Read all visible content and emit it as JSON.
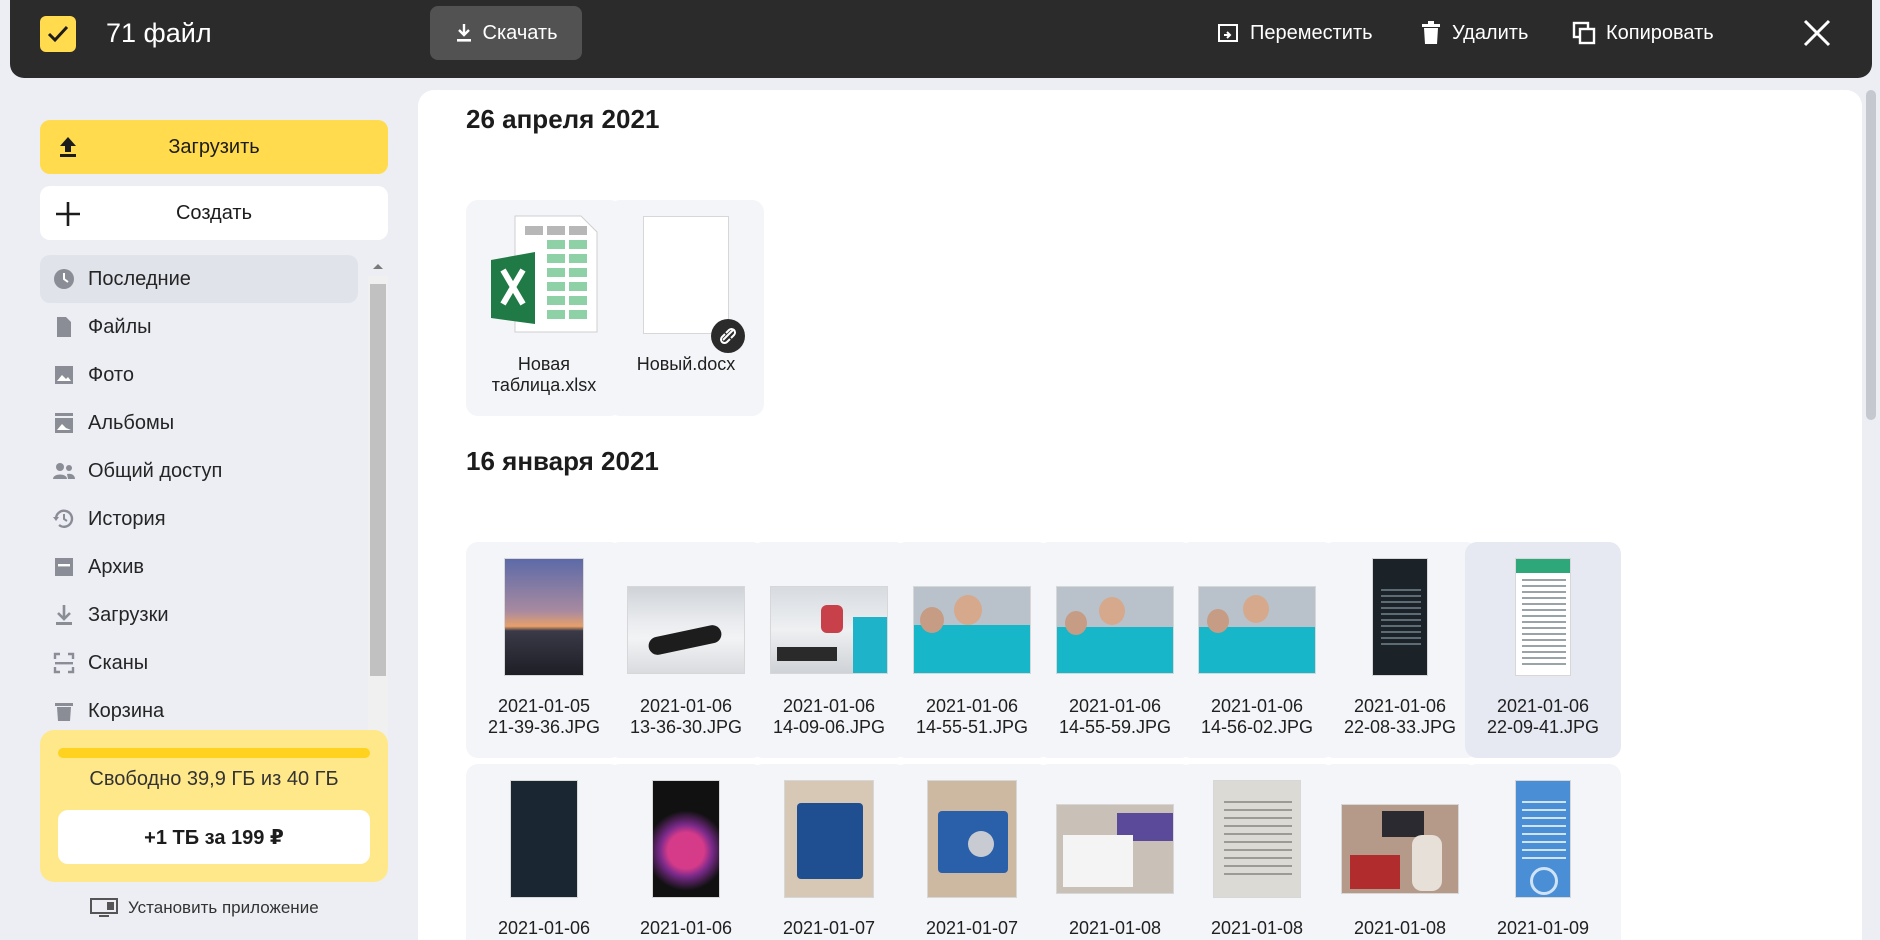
{
  "topbar": {
    "count": "71 файл",
    "download_label": "Скачать",
    "move_label": "Переместить",
    "delete_label": "Удалить",
    "copy_label": "Копировать",
    "accent": "#ffdb4d"
  },
  "sidebar": {
    "upload_label": "Загрузить",
    "create_label": "Создать",
    "items": [
      {
        "label": "Последние",
        "icon": "clock-icon"
      },
      {
        "label": "Файлы",
        "icon": "file-icon"
      },
      {
        "label": "Фото",
        "icon": "photo-icon"
      },
      {
        "label": "Альбомы",
        "icon": "album-icon"
      },
      {
        "label": "Общий доступ",
        "icon": "people-icon"
      },
      {
        "label": "История",
        "icon": "history-icon"
      },
      {
        "label": "Архив",
        "icon": "archive-icon"
      },
      {
        "label": "Загрузки",
        "icon": "download-icon"
      },
      {
        "label": "Сканы",
        "icon": "scan-icon"
      },
      {
        "label": "Корзина",
        "icon": "trash-icon"
      }
    ],
    "storage_text": "Свободно 39,9 ГБ из 40 ГБ",
    "buy_label": "+1 ТБ за 199 ₽",
    "install_label": "Установить приложение"
  },
  "main": {
    "groups": [
      {
        "date": "26 апреля 2021",
        "files": [
          {
            "name1": "Новая",
            "name2": "таблица.xlsx"
          },
          {
            "name1": "Новый.docx",
            "name2": ""
          }
        ]
      },
      {
        "date": "16 января 2021",
        "files": [
          {
            "name1": "2021-01-05",
            "name2": "21-39-36.JPG"
          },
          {
            "name1": "2021-01-06",
            "name2": "13-36-30.JPG"
          },
          {
            "name1": "2021-01-06",
            "name2": "14-09-06.JPG"
          },
          {
            "name1": "2021-01-06",
            "name2": "14-55-51.JPG"
          },
          {
            "name1": "2021-01-06",
            "name2": "14-55-59.JPG"
          },
          {
            "name1": "2021-01-06",
            "name2": "14-56-02.JPG"
          },
          {
            "name1": "2021-01-06",
            "name2": "22-08-33.JPG"
          },
          {
            "name1": "2021-01-06",
            "name2": "22-09-41.JPG"
          },
          {
            "name1": "2021-01-06",
            "name2": ""
          },
          {
            "name1": "2021-01-06",
            "name2": ""
          },
          {
            "name1": "2021-01-07",
            "name2": ""
          },
          {
            "name1": "2021-01-07",
            "name2": ""
          },
          {
            "name1": "2021-01-08",
            "name2": ""
          },
          {
            "name1": "2021-01-08",
            "name2": ""
          },
          {
            "name1": "2021-01-08",
            "name2": ""
          },
          {
            "name1": "2021-01-09",
            "name2": ""
          }
        ]
      }
    ]
  }
}
